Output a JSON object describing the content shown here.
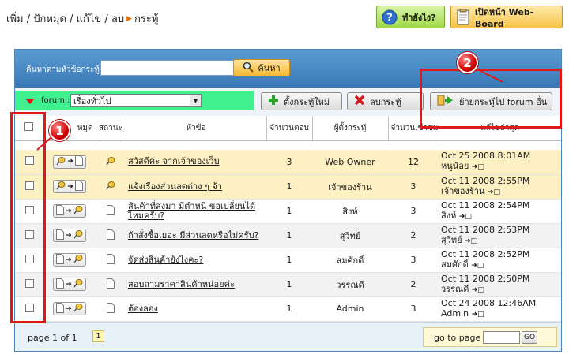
{
  "breadcrumb": {
    "prefix": "เพิ่ม / ปักหมุด / แก้ไข / ลบ",
    "current": "กระทู้"
  },
  "top_buttons": {
    "help": "ทำยังไง?",
    "board": "เปิดหน้า Web-Board"
  },
  "search": {
    "label": "ค้นหาตามหัวข้อกระทู้",
    "value": "",
    "button": "ค้นหา"
  },
  "forum": {
    "label": "forum :",
    "selected": "เรื่องทั่วไป"
  },
  "actions": {
    "new_topic": "ตั้งกระทู้ใหม่",
    "delete": "ลบกระทู้",
    "move": "ย้ายกระทู้ไป forum อื่น"
  },
  "columns": {
    "pin": "หมุด",
    "status": "สถานะ",
    "subject": "หัวข้อ",
    "replies": "จำนวนตอบ",
    "author": "ผู้ตั้งกระทู้",
    "views": "จำนวนเข้าชม",
    "last": "แก้ไขล่าสุด"
  },
  "rows": [
    {
      "subject": "สวัสดีค่ะ จากเจ้าของเว็บ",
      "replies": "3",
      "author": "Web Owner",
      "views": "12",
      "last_date": "Oct 25 2008 8:01AM",
      "last_user": "หนูน้อย",
      "pinned": true
    },
    {
      "subject": "แจ้งเรื่องส่วนลดต่าง ๆ จ้า",
      "replies": "1",
      "author": "เจ้าของร้าน",
      "views": "3",
      "last_date": "Oct 11 2008 2:55PM",
      "last_user": "เจ้าของร้าน",
      "pinned": true
    },
    {
      "subject": "สินค้าที่ส่งมา มีตำหนิ ขอเปลี่ยนได้ไหมครับ?",
      "replies": "1",
      "author": "สิงห์",
      "views": "3",
      "last_date": "Oct 11 2008 2:54PM",
      "last_user": "สิงห์",
      "pinned": false
    },
    {
      "subject": "ถ้าสั่งซื้อเยอะ มีส่วนลดหรือไม่ครับ?",
      "replies": "1",
      "author": "สุวิทย์",
      "views": "2",
      "last_date": "Oct 11 2008 2:53PM",
      "last_user": "สุวิทย์",
      "pinned": false
    },
    {
      "subject": "จัดส่งสินค้ายังไงคะ?",
      "replies": "1",
      "author": "สมศักดิ์",
      "views": "3",
      "last_date": "Oct 11 2008 2:52PM",
      "last_user": "สมศักดิ์",
      "pinned": false
    },
    {
      "subject": "สอบถามราคาสินค้าหน่อยค่ะ",
      "replies": "1",
      "author": "วรรณดี",
      "views": "2",
      "last_date": "Oct 11 2008 2:50PM",
      "last_user": "วรรณดี",
      "pinned": false
    },
    {
      "subject": "ต้องลอง",
      "replies": "1",
      "author": "Admin",
      "views": "3",
      "last_date": "Oct 24 2008 12:46AM",
      "last_user": "Admin",
      "pinned": false
    }
  ],
  "footer": {
    "page_info": "page 1 of 1",
    "page_num": "1",
    "goto_label": "go to page",
    "go_button": "GO"
  },
  "callouts": {
    "one": "1",
    "two": "2"
  },
  "colors": {
    "accent_blue": "#3a78b5",
    "forum_green": "#3ff28f",
    "highlight_row": "#fdf0c3",
    "callout_red": "#e01818"
  }
}
